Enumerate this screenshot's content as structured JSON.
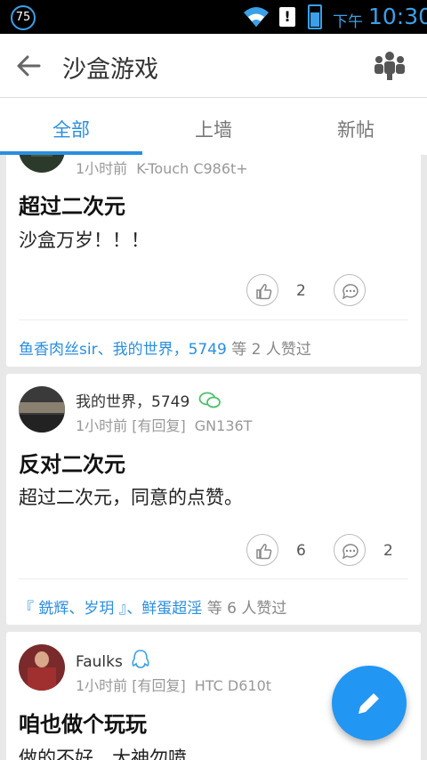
{
  "status_bar": {
    "badge": "75",
    "ampm": "下午",
    "time": "10:30"
  },
  "app_bar": {
    "title": "沙盒游戏"
  },
  "tabs": [
    {
      "label": "全部"
    },
    {
      "label": "上墙"
    },
    {
      "label": "新帖"
    }
  ],
  "posts": [
    {
      "meta_time": "1小时前",
      "meta_device": "K-Touch C986t+",
      "title": "超过二次元",
      "body": "沙盒万岁！！！",
      "like_count": "2",
      "comment_count": "",
      "likers": "鱼香肉丝sir、我的世界，5749",
      "likers_suffix": "等 2 人赞过"
    },
    {
      "author": "我的世界，5749",
      "meta_time": "1小时前 [有回复]",
      "meta_device": "GN136T",
      "title": "反对二次元",
      "body": "超过二次元，同意的点赞。",
      "like_count": "6",
      "comment_count": "2",
      "likers": "『 銑辉、岁玥 』、鲜蛋超淫",
      "likers_suffix": "等 6 人赞过"
    },
    {
      "author": "Faulks",
      "meta_time": "1小时前 [有回复]",
      "meta_device": "HTC D610t",
      "title": "咱也做个玩玩",
      "body": "做的不好，大神勿喷"
    }
  ],
  "colors": {
    "accent": "#2a8fe0",
    "fab": "#2196f3",
    "wechat": "#4cc26a",
    "qq": "#3aa0e8"
  },
  "icons": [
    "back-arrow-icon",
    "members-icon",
    "thumbs-up-icon",
    "comment-icon",
    "wechat-icon",
    "qq-icon",
    "edit-pencil-icon",
    "wifi-icon",
    "battery-icon"
  ]
}
